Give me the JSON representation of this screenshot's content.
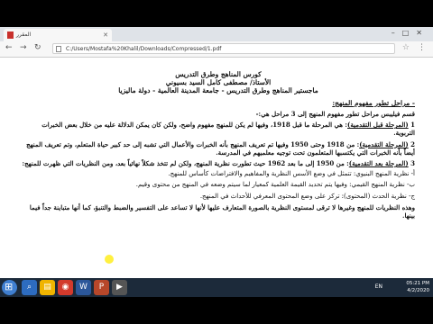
{
  "tab": {
    "title": "المقرر"
  },
  "address": {
    "url": "C:/Users/Mostafa%20Khalil/Downloads/Compressed/1.pdf"
  },
  "doc": {
    "header_line1": "كورس المناهج وطرق التدريس",
    "header_line2": "الأستاذ/ مصطفى كامل السيد بسيوني",
    "header_line3": "ماجستير المناهج وطرق التدريس - جامعة المدينة العالمية - دولة ماليزيا",
    "section_title": "- مراحل تطور مفهوم المنهج:",
    "intro": "قسم فيليبس مراحل تطور مفهوم المنهج إلى 3 مراحل هي:-",
    "stage1_label": "1",
    "stage1_title": "(المرحلة قبل التقدمية)",
    "stage1_text": ": هي المرحلة ما قبل 1918، وفيها لم يكن للمنهج مفهوم واضح، ولكن كان يمكن الدلالة عليه من خلال بعض الخبرات التربوية.",
    "stage2_label": "2",
    "stage2_title": "(المرحلة التقدمية)",
    "stage2_text": ": من 1918 وحتى 1950 وفيها تم تعريف المنهج بأنه الخبرات والأعمال التي تشبه إلى حد كبير حياة المتعلم، وتم تعريف المنهج أيضاً بأنه الخبرات التي يكتسبها المتعلمون تحت توجيه معلميهم في المدرسة.",
    "stage3_label": "3",
    "stage3_title": "(المرحلة بعد التقدمية)",
    "stage3_text": ": من 1950 إلى ما بعد 1962 حيث تطورت نظرية المنهج، ولكن لم تتخذ شكلاً نهائياً بعد، ومن النظريات التي ظهرت للمنهج:",
    "theory_a": "أ- نظرية المنهج البنيوي: تتمثل في وضع الأسس النظرية والمفاهيم والافتراضات كأساس للمنهج.",
    "theory_b": "ب- نظرية المنهج القيمي: وفيها يتم تحديد القيمة العلمية كمعيار لما سيتم وضعه في المنهج من محتوى وقيم.",
    "theory_c": "ج- نظرية الحدث (المحتوى): تركز على وضع المحتوى المعرفي للأحداث في المنهج.",
    "closing": "وهذه النظريات للمنهج وغيرها لا ترقى لمستوى النظرية بالصورة المتعارف عليها لأنها لا تساعد على التفسير والضبط والتنبؤ، كما أنها متباينة جداً فيما بينها."
  },
  "taskbar": {
    "lang": "EN",
    "time": "05:21 PM",
    "date": "4/2/2020"
  },
  "colors": {
    "taskbar": "#1c2a3a",
    "viewer_bg": "#525659",
    "highlight": "#ffeb00"
  },
  "icons": [
    "back-icon",
    "forward-icon",
    "reload-icon",
    "file-icon",
    "star-icon",
    "menu-icon",
    "windows-start-icon"
  ]
}
